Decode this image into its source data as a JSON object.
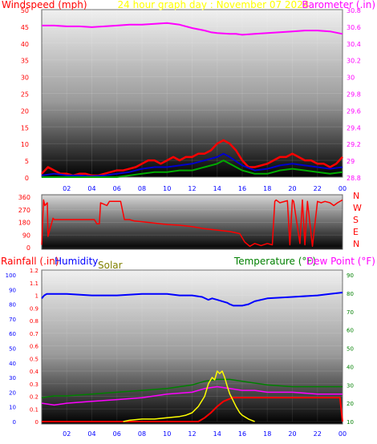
{
  "colors": {
    "windspeed": "#ff0000",
    "barometer": "#ff00ff",
    "date": "#ffff00",
    "direction": "#ff0000",
    "rainfall": "#ff0000",
    "humidity": "#0000ff",
    "solar": "#808000",
    "temperature": "#008000",
    "dewpoint": "#ff00ff",
    "axis_left": "#ff0000",
    "axis_right_baro": "#ff00ff",
    "axis_right_temp": "#008000",
    "axis_hum": "#0000ff",
    "time": "#0000ff"
  },
  "chart_data": [
    {
      "type": "line",
      "title": "24 hour graph day : November 07 2024",
      "left_axis_label": "Windspeed (mph)",
      "right_axis_label": "Barometer (.in)",
      "x_ticks": [
        "02",
        "04",
        "06",
        "08",
        "10",
        "12",
        "14",
        "16",
        "18",
        "20",
        "22",
        "00"
      ],
      "left_ticks": [
        "0",
        "5",
        "10",
        "15",
        "20",
        "25",
        "30",
        "35",
        "40",
        "45",
        "50"
      ],
      "right_ticks": [
        "28.8",
        "29",
        "29.2",
        "29.4",
        "29.6",
        "29.8",
        "30",
        "30.2",
        "30.4",
        "30.6",
        "30.8"
      ],
      "ylim_left": [
        0,
        50
      ],
      "ylim_right": [
        28.8,
        30.8
      ],
      "series": [
        {
          "name": "Barometer",
          "axis": "right",
          "x": [
            0,
            1,
            2,
            3,
            4,
            5,
            6,
            7,
            8,
            9,
            10,
            10.5,
            11,
            12,
            13,
            13.5,
            14,
            15,
            15.5,
            16,
            17,
            18,
            19,
            20,
            21,
            22,
            23,
            24
          ],
          "values": [
            30.61,
            30.61,
            30.6,
            30.6,
            30.59,
            30.6,
            30.61,
            30.62,
            30.62,
            30.63,
            30.64,
            30.63,
            30.62,
            30.58,
            30.55,
            30.53,
            30.52,
            30.51,
            30.51,
            30.5,
            30.51,
            30.52,
            30.53,
            30.54,
            30.55,
            30.55,
            30.54,
            30.51
          ]
        },
        {
          "name": "Windspeed",
          "axis": "left",
          "x": [
            0,
            0.5,
            1,
            1.5,
            2,
            2.5,
            3,
            3.5,
            4,
            4.5,
            5,
            5.5,
            6,
            6.5,
            7,
            7.5,
            8,
            8.5,
            9,
            9.5,
            10,
            10.5,
            11,
            11.5,
            12,
            12.5,
            13,
            13.5,
            14,
            14.5,
            15,
            15.5,
            16,
            16.5,
            17,
            17.5,
            18,
            18.5,
            19,
            19.5,
            20,
            20.5,
            21,
            21.5,
            22,
            22.5,
            23,
            23.5,
            24
          ],
          "values": [
            1,
            3,
            2,
            1,
            1,
            0.5,
            1,
            1,
            0.5,
            0.5,
            1,
            1.5,
            2,
            2,
            2.5,
            3,
            4,
            5,
            5,
            4,
            5,
            6,
            5,
            6,
            6,
            7,
            7,
            8,
            10,
            11,
            10,
            8,
            5,
            3,
            3,
            3.5,
            4,
            5,
            6,
            6,
            7,
            6,
            5,
            5,
            4,
            4,
            3,
            4,
            6
          ]
        },
        {
          "name": "Wind average",
          "axis": "left",
          "x": [
            0,
            1,
            2,
            3,
            4,
            5,
            6,
            7,
            8,
            9,
            10,
            11,
            12,
            13,
            14,
            14.5,
            15,
            16,
            17,
            18,
            19,
            20,
            21,
            22,
            23,
            24
          ],
          "values": [
            0.5,
            1,
            0.5,
            0.5,
            0.3,
            0.5,
            1,
            1.5,
            2.5,
            3,
            3,
            3.5,
            4,
            5,
            6,
            7,
            6,
            3.5,
            2,
            2.5,
            3.5,
            4,
            3.5,
            3,
            2.5,
            3
          ]
        },
        {
          "name": "Wind low",
          "axis": "left",
          "x": [
            0,
            1,
            2,
            3,
            4,
            5,
            6,
            7,
            8,
            9,
            10,
            11,
            12,
            13,
            14,
            14.5,
            15,
            16,
            17,
            18,
            19,
            20,
            21,
            22,
            23,
            24
          ],
          "values": [
            0,
            0,
            0,
            0,
            0,
            0,
            0,
            0.5,
            1,
            1.5,
            1.5,
            2,
            2,
            3,
            4,
            5,
            4,
            2,
            1,
            1,
            2,
            2.5,
            2,
            1.5,
            1,
            1.5
          ]
        }
      ]
    },
    {
      "type": "line",
      "title": "",
      "left_ticks": [
        "0",
        "90",
        "180",
        "270",
        "360"
      ],
      "right_ticks": [
        "N",
        "W",
        "S",
        "E",
        "N"
      ],
      "ylim": [
        0,
        360
      ],
      "series": [
        {
          "name": "Wind direction",
          "x": [
            0,
            0.15,
            0.25,
            0.45,
            0.5,
            0.9,
            1.0,
            4.2,
            4.4,
            4.6,
            4.7,
            5.2,
            5.4,
            6.3,
            6.6,
            7.0,
            7.4,
            8.0,
            9.0,
            10.0,
            11.0,
            12.0,
            13.0,
            14.0,
            15.0,
            15.8,
            16.2,
            16.6,
            17.0,
            17.5,
            18.0,
            18.4,
            18.6,
            18.7,
            19.0,
            19.6,
            19.8,
            20.0,
            20.1,
            20.6,
            20.8,
            21.0,
            21.2,
            21.6,
            22.0,
            22.3,
            22.6,
            23.0,
            23.3,
            23.6,
            24.0
          ],
          "values": [
            20,
            340,
            300,
            320,
            80,
            210,
            200,
            200,
            170,
            170,
            320,
            300,
            330,
            330,
            200,
            200,
            190,
            185,
            175,
            165,
            160,
            150,
            135,
            125,
            115,
            100,
            40,
            10,
            30,
            15,
            30,
            20,
            330,
            340,
            320,
            335,
            20,
            340,
            330,
            30,
            340,
            20,
            330,
            10,
            330,
            320,
            330,
            320,
            300,
            320,
            340
          ]
        }
      ]
    },
    {
      "type": "line",
      "title": "",
      "left_axis_label": "Rainfall (.in)",
      "hum_axis_label": "Humidity",
      "solar_label": "Solar",
      "right_axis_label": "Temperature (°F)",
      "dew_label": "Dew Point (°F)",
      "x_ticks": [
        "02",
        "04",
        "06",
        "08",
        "10",
        "12",
        "14",
        "16",
        "18",
        "20",
        "22",
        "00"
      ],
      "hum_ticks": [
        "0",
        "10",
        "20",
        "30",
        "40",
        "50",
        "60",
        "70",
        "80",
        "90",
        "100"
      ],
      "rain_ticks": [
        "0",
        "0.1",
        "0.2",
        "0.3",
        "0.4",
        "0.5",
        "0.6",
        "0.7",
        "0.8",
        "0.9",
        "1",
        "1.1",
        "1.2"
      ],
      "temp_ticks": [
        "10",
        "20",
        "30",
        "40",
        "50",
        "60",
        "70",
        "80",
        "90"
      ],
      "ylim_rain": [
        0,
        1.2
      ],
      "ylim_temp": [
        10,
        90
      ],
      "series": [
        {
          "name": "Humidity",
          "axis": "hum",
          "x": [
            0,
            0.2,
            0.4,
            1,
            2,
            4,
            6,
            8,
            10,
            11,
            12,
            12.8,
            13.3,
            13.6,
            14,
            14.4,
            14.8,
            15,
            15.3,
            16,
            16.5,
            17,
            18,
            20,
            22,
            23,
            24
          ],
          "values": [
            84,
            86,
            87,
            87,
            87,
            86,
            86,
            87,
            87,
            86,
            86,
            85,
            83,
            84,
            83,
            82,
            81,
            80,
            79,
            79,
            80,
            82,
            84,
            85,
            86,
            87,
            88
          ]
        },
        {
          "name": "Temperature",
          "axis": "temp",
          "x": [
            0,
            1,
            2,
            4,
            6,
            8,
            10,
            12,
            13,
            14,
            15,
            16,
            17,
            18,
            20,
            22,
            24
          ],
          "values": [
            23,
            24,
            24,
            25,
            26,
            27,
            28,
            30,
            32,
            33,
            33,
            32,
            31,
            30,
            29,
            29,
            29
          ]
        },
        {
          "name": "Dew Point",
          "axis": "temp",
          "x": [
            0,
            1,
            2,
            4,
            6,
            8,
            10,
            12,
            13,
            14,
            15,
            16,
            17,
            18,
            20,
            22,
            24
          ],
          "values": [
            20,
            19,
            20,
            21,
            22,
            23,
            25,
            26,
            28,
            29,
            28,
            27,
            27,
            26,
            26,
            25,
            25
          ]
        },
        {
          "name": "Rainfall",
          "axis": "rain",
          "x": [
            0,
            10,
            11,
            12,
            12.5,
            13,
            13.5,
            14,
            14.5,
            15,
            15.2,
            15.4,
            20,
            23.8,
            24
          ],
          "values": [
            0,
            0,
            0,
            0,
            0,
            0.03,
            0.07,
            0.12,
            0.16,
            0.18,
            0.19,
            0.19,
            0.19,
            0.19,
            0
          ]
        },
        {
          "name": "Solar",
          "axis": "rain",
          "x": [
            6.5,
            7,
            8,
            9,
            10,
            11,
            11.5,
            12,
            12.5,
            13,
            13.3,
            13.6,
            13.8,
            14,
            14.2,
            14.4,
            14.6,
            14.8,
            15,
            15.2,
            15.5,
            15.8,
            16,
            16.5,
            17
          ],
          "values": [
            0,
            0.01,
            0.02,
            0.02,
            0.03,
            0.04,
            0.05,
            0.07,
            0.12,
            0.2,
            0.3,
            0.35,
            0.33,
            0.4,
            0.38,
            0.4,
            0.35,
            0.28,
            0.22,
            0.18,
            0.12,
            0.07,
            0.05,
            0.02,
            0
          ]
        }
      ]
    }
  ]
}
